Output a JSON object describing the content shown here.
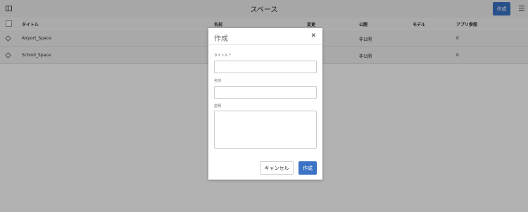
{
  "header": {
    "title": "スペース",
    "create_label": "作成",
    "rail_icon": "rail-toggle-icon",
    "view_icon": "list-view-icon"
  },
  "table": {
    "columns": [
      "タイトル",
      "名前",
      "変更",
      "公開",
      "モデル",
      "アプリ参照"
    ],
    "rows": [
      {
        "title": "Airport_Space",
        "published": "非公開",
        "app_refs": "0"
      },
      {
        "title": "School_Space",
        "published": "非公開",
        "app_refs": "0"
      }
    ]
  },
  "dialog": {
    "title": "作成",
    "close_glyph": "✕",
    "fields": {
      "title_label": "タイトル *",
      "name_label": "名前",
      "desc_label": "説明"
    },
    "cancel_label": "キャンセル",
    "confirm_label": "作成"
  },
  "colors": {
    "primary_button": "#3a73c6",
    "overlay": "rgba(0,0,0,0.3)"
  }
}
